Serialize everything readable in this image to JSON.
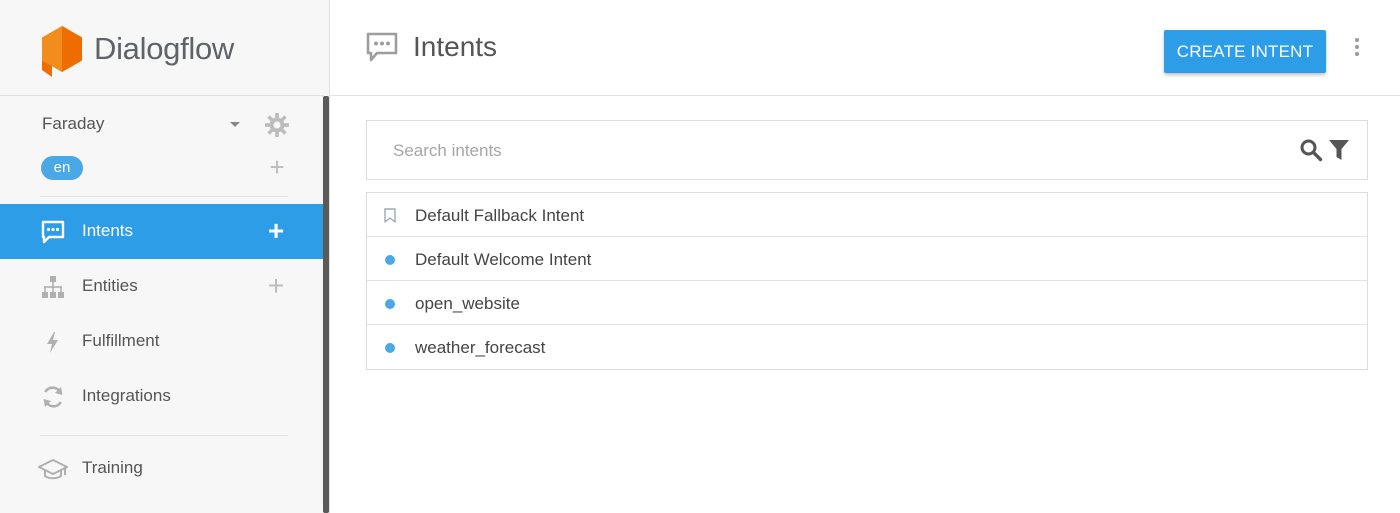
{
  "app": {
    "name": "Dialogflow",
    "brand_color": "#f28c1b",
    "accent_color": "#2d9de8"
  },
  "sidebar": {
    "agent_name": "Faraday",
    "language": "en",
    "nav": [
      {
        "label": "Intents",
        "icon": "chat-icon",
        "active": true,
        "has_add": true
      },
      {
        "label": "Entities",
        "icon": "entities-icon",
        "active": false,
        "has_add": true
      },
      {
        "label": "Fulfillment",
        "icon": "bolt-icon",
        "active": false,
        "has_add": false
      },
      {
        "label": "Integrations",
        "icon": "sync-icon",
        "active": false,
        "has_add": false
      },
      {
        "label": "Training",
        "icon": "graduation-cap-icon",
        "active": false,
        "has_add": false
      }
    ]
  },
  "header": {
    "title": "Intents",
    "create_label": "CREATE INTENT"
  },
  "search": {
    "placeholder": "Search intents"
  },
  "intents": [
    {
      "name": "Default Fallback Intent",
      "marker": "bookmark"
    },
    {
      "name": "Default Welcome Intent",
      "marker": "dot"
    },
    {
      "name": "open_website",
      "marker": "dot"
    },
    {
      "name": "weather_forecast",
      "marker": "dot"
    }
  ]
}
